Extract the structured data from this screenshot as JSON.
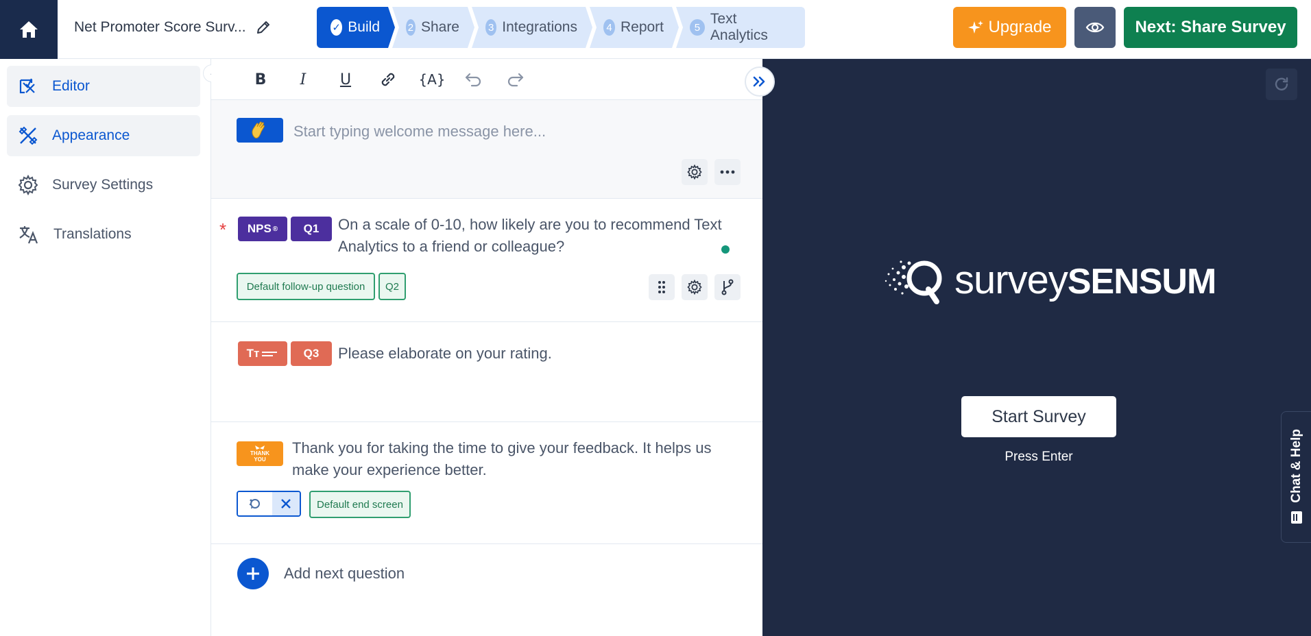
{
  "header": {
    "survey_title": "Net Promoter Score Surv...",
    "steps": [
      {
        "num": "✓",
        "label": "Build"
      },
      {
        "num": "2",
        "label": "Share"
      },
      {
        "num": "3",
        "label": "Integrations"
      },
      {
        "num": "4",
        "label": "Report"
      },
      {
        "num": "5",
        "label": "Text Analytics"
      }
    ],
    "upgrade_label": "Upgrade",
    "next_label": "Next: Share Survey"
  },
  "sidebar": {
    "items": [
      {
        "label": "Editor"
      },
      {
        "label": "Appearance"
      },
      {
        "label": "Survey Settings"
      },
      {
        "label": "Translations"
      }
    ]
  },
  "toolbar": {
    "bold": "B",
    "italic": "I",
    "underline": "U",
    "variable": "{A}"
  },
  "welcome": {
    "placeholder": "Start typing welcome message here..."
  },
  "questions": [
    {
      "type_badge": "NPS",
      "type_badge_sup": "®",
      "number": "Q1",
      "text": "On a scale of 0-10, how likely are you to recommend Text Analytics to a friend or colleague?",
      "followup_tag": "Default follow-up question",
      "followup_number": "Q2"
    },
    {
      "type_badge": "Tт",
      "number": "Q3",
      "text": "Please elaborate on your rating."
    }
  ],
  "thank_you": {
    "badge_line1": "THANK",
    "badge_line2": "YOU",
    "text": "Thank you for taking the time to give your feedback. It helps us make your experience better.",
    "end_tag": "Default end screen"
  },
  "add_question_label": "Add next question",
  "preview": {
    "logo_light": "survey",
    "logo_bold": "SENSUM",
    "start_label": "Start Survey",
    "hint": "Press Enter",
    "chat_help": "Chat & Help"
  },
  "colors": {
    "primary_blue": "#0b57d0",
    "upgrade_orange": "#f7941d",
    "next_green": "#0e8050",
    "nps_purple": "#4c2f9e",
    "text_q_red": "#e06a55",
    "preview_bg": "#1f2a44"
  }
}
